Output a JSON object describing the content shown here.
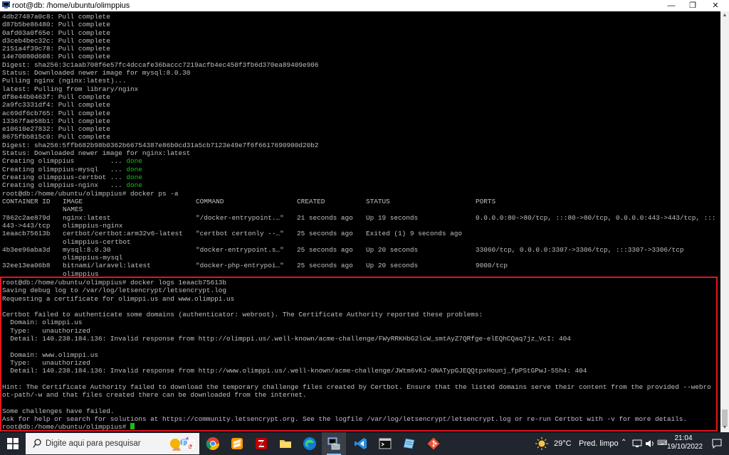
{
  "window": {
    "title": "root@db: /home/ubuntu/olimppius",
    "icon": "putty-icon",
    "controls": {
      "minimize": "—",
      "maximize": "❐",
      "close": "✕"
    }
  },
  "terminal": {
    "top_lines": [
      {
        "text": "4db27487a0c8: Pull complete"
      },
      {
        "text": "d87b5be86480: Pull complete"
      },
      {
        "text": "0afd03a0f65e: Pull complete"
      },
      {
        "text": "d3ceb4bec32c: Pull complete"
      },
      {
        "text": "2151a4f39c78: Pull complete"
      },
      {
        "text": "14e70080d608: Pull complete"
      },
      {
        "text": "Digest: sha256:3c1aab708f6e57fc4dccafe36baccc7219acfb4ec450f3fb6d370ea89409e906"
      },
      {
        "text": "Status: Downloaded newer image for mysql:8.0.30"
      },
      {
        "text": "Pulling nginx (nginx:latest)..."
      },
      {
        "text": "latest: Pulling from library/nginx"
      },
      {
        "text": "df8e44b0463f: Pull complete"
      },
      {
        "text": "2a9fc3331df4: Pull complete"
      },
      {
        "text": "ac69df6cb765: Pull complete"
      },
      {
        "text": "13367fae58b1: Pull complete"
      },
      {
        "text": "e10610e27832: Pull complete"
      },
      {
        "text": "8675fbb815c0: Pull complete"
      },
      {
        "text": "Digest: sha256:5ffb682b98b0362b66754387e86b0cd31a5cb7123e49e7f6f6617690900d20b2"
      },
      {
        "text": "Status: Downloaded newer image for nginx:latest"
      },
      {
        "text": "Creating olimppius         ... ",
        "status": "done"
      },
      {
        "text": "Creating olimppius-mysql   ... ",
        "status": "done"
      },
      {
        "text": "Creating olimppius-certbot ... ",
        "status": "done"
      },
      {
        "text": "Creating olimppius-nginx   ... ",
        "status": "done"
      },
      {
        "text": "root@db:/home/ubuntu/olimppius# docker ps -a"
      }
    ],
    "ps_table": {
      "headers": {
        "container_id": "CONTAINER ID",
        "image": "IMAGE",
        "command": "COMMAND",
        "created": "CREATED",
        "status": "STATUS",
        "ports": "PORTS",
        "names": "NAMES"
      },
      "rows": [
        {
          "container_id": "7862c2ae879d",
          "image": "nginx:latest",
          "command": "\"/docker-entrypoint.…\"",
          "created": "21 seconds ago",
          "status": "Up 19 seconds",
          "ports": "0.0.0.0:80->80/tcp, :::80->80/tcp, 0.0.0.0:443->443/tcp, :::",
          "ports_wrap": "443->443/tcp",
          "names": "olimppius-nginx"
        },
        {
          "container_id": "1eaacb75613b",
          "image": "certbot/certbot:arm32v6-latest",
          "command": "\"certbot certonly --…\"",
          "created": "25 seconds ago",
          "status": "Exited (1) 9 seconds ago",
          "ports": "",
          "ports_wrap": "",
          "names": "olimppius-certbot"
        },
        {
          "container_id": "4b3ee96aba3d",
          "image": "mysql:8.0.30",
          "command": "\"docker-entrypoint.s…\"",
          "created": "25 seconds ago",
          "status": "Up 20 seconds",
          "ports": "33060/tcp, 0.0.0.0:3307->3306/tcp, :::3307->3306/tcp",
          "ports_wrap": "",
          "names": "olimppius-mysql"
        },
        {
          "container_id": "32ee13ea06b8",
          "image": "bitnami/laravel:latest",
          "command": "\"docker-php-entrypoi…\"",
          "created": "25 seconds ago",
          "status": "Up 20 seconds",
          "ports": "9000/tcp",
          "ports_wrap": "",
          "names": "olimppius"
        }
      ]
    },
    "bottom_lines": [
      {
        "text": "root@db:/home/ubuntu/olimppius# docker logs 1eaacb75613b"
      },
      {
        "text": "Saving debug log to /var/log/letsencrypt/letsencrypt.log"
      },
      {
        "text": "Requesting a certificate for olimppi.us and www.olimppi.us"
      },
      {
        "text": ""
      },
      {
        "text": "Certbot failed to authenticate some domains (authenticator: webroot). The Certificate Authority reported these problems:"
      },
      {
        "text": "  Domain: olimppi.us"
      },
      {
        "text": "  Type:   unauthorized"
      },
      {
        "text": "  Detail: 140.238.184.136: Invalid response from http://olimppi.us/.well-known/acme-challenge/FWyRRKHbG2lcW_smtAyZ7QRfge-elEQhCQaq7jz_VcI: 404"
      },
      {
        "text": ""
      },
      {
        "text": "  Domain: www.olimppi.us"
      },
      {
        "text": "  Type:   unauthorized"
      },
      {
        "text": "  Detail: 140.238.184.136: Invalid response from http://www.olimppi.us/.well-known/acme-challenge/JWtm6vKJ-ONATypGJEQQtpxHounj_fpPStGPwJ-55h4: 404"
      },
      {
        "text": ""
      },
      {
        "text": "Hint: The Certificate Authority failed to download the temporary challenge files created by Certbot. Ensure that the listed domains serve their content from the provided --webro"
      },
      {
        "text": "ot-path/-w and that files created there can be downloaded from the internet."
      },
      {
        "text": ""
      },
      {
        "text": "Some challenges have failed."
      },
      {
        "text": "Ask for help or search for solutions at https://community.letsencrypt.org. See the logfile /var/log/letsencrypt/letsencrypt.log or re-run Certbot with -v for more details."
      }
    ],
    "prompt": "root@db:/home/ubuntu/olimppius# "
  },
  "taskbar": {
    "search_placeholder": "Digite aqui para pesquisar",
    "apps": [
      {
        "name": "task-view-icon"
      },
      {
        "name": "chrome-icon"
      },
      {
        "name": "sublime-text-icon"
      },
      {
        "name": "filezilla-icon"
      },
      {
        "name": "file-explorer-icon"
      },
      {
        "name": "edge-icon"
      },
      {
        "name": "putty-icon"
      },
      {
        "name": "vscode-icon"
      },
      {
        "name": "terminal-icon"
      },
      {
        "name": "notepad-icon"
      },
      {
        "name": "git-icon"
      }
    ],
    "weather": {
      "temp": "29°C",
      "desc": "Pred. limpo"
    },
    "clock": {
      "time": "21:04",
      "date": "19/10/2022"
    },
    "colors": {
      "background": "#20252e",
      "accent": "#8fc3f5"
    }
  },
  "colors": {
    "terminal_bg": "#000000",
    "terminal_fg": "#c0c0c0",
    "done": "#13c20e",
    "highlight": "#e8141c"
  }
}
